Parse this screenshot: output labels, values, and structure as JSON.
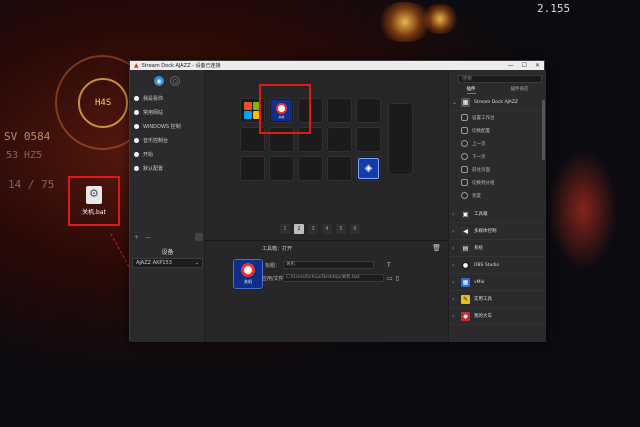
{
  "desktop": {
    "file_name": "关机.bat",
    "hud_left": [
      "SV 0584",
      "53 HZ5",
      "14 / 75"
    ],
    "hud_top": "2.155",
    "hud_ring_label": "H4S",
    "markers": [
      "!",
      "!"
    ]
  },
  "window": {
    "title": "Stream Dock AJAZZ - 设备已连接",
    "controls": [
      "—",
      "☐",
      "✕"
    ]
  },
  "left_panel": {
    "profiles": [
      "我是看你",
      "常用网站",
      "WINDOWS 控制",
      "音乐控制台",
      "开始",
      "默认配置"
    ],
    "bottom_add": "+",
    "bottom_remove": "—",
    "device_header": "设备",
    "device_selected": "AJAZZ AKP153"
  },
  "deck": {
    "selected_key_label": "关机",
    "pages": [
      "1",
      "2",
      "3",
      "4",
      "5",
      "6"
    ],
    "active_page": "2"
  },
  "properties": {
    "header": "工具箱：打开",
    "preview_label": "关机",
    "title_label": "标题：",
    "title_value": "关机",
    "file_label": "应用/文件：",
    "file_value": "C:/Users/hchua/Desktop/关机.bat",
    "trash_icon": "🗑",
    "title_tool": "T"
  },
  "right_panel": {
    "search_placeholder": "搜索",
    "tabs": [
      "插件",
      "插件商店"
    ],
    "device_category": "Stream Dock AJAZZ",
    "actions": [
      "设置工作台",
      "切换配置",
      "上一页",
      "下一页",
      "前往页面",
      "切换到分组",
      "亮度"
    ],
    "categories": [
      "工具箱",
      "多媒体控制",
      "系统",
      "OBS Studio",
      "vMix",
      "实用工具",
      "我的大车"
    ]
  },
  "colors": {
    "accent": "#2e8fd8",
    "highlight": "#e21818",
    "key_blue": "#0d2f8a"
  }
}
